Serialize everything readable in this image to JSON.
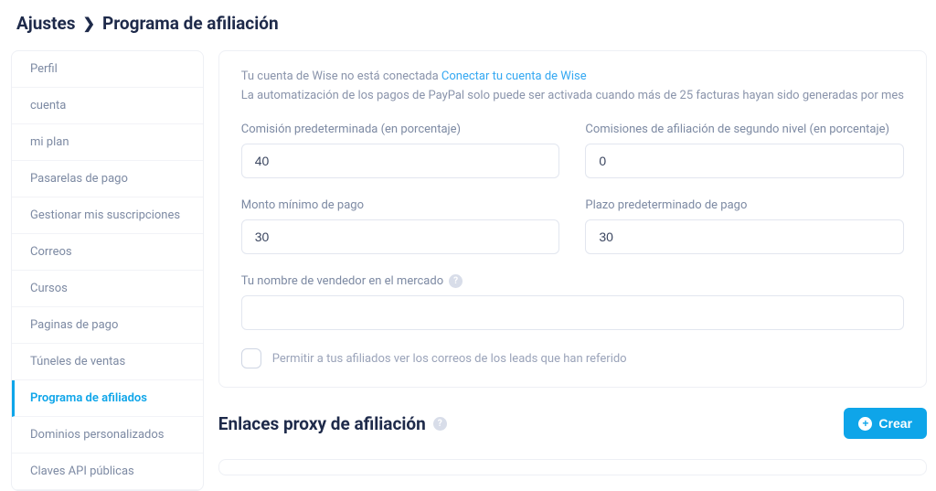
{
  "breadcrumb": {
    "root": "Ajustes",
    "current": "Programa de afiliación"
  },
  "sidebar": {
    "items": [
      {
        "label": "Perfil"
      },
      {
        "label": "cuenta"
      },
      {
        "label": "mi plan"
      },
      {
        "label": "Pasarelas de pago"
      },
      {
        "label": "Gestionar mis suscripciones"
      },
      {
        "label": "Correos"
      },
      {
        "label": "Cursos"
      },
      {
        "label": "Paginas de pago"
      },
      {
        "label": "Túneles de ventas"
      },
      {
        "label": "Programa de afiliados"
      },
      {
        "label": "Dominios personalizados"
      },
      {
        "label": "Claves API públicas"
      }
    ],
    "active_index": 9
  },
  "notice": {
    "prefix": "Tu cuenta de Wise no está conectada",
    "link": "Conectar tu cuenta de Wise",
    "line2": "La automatización de los pagos de PayPal solo puede ser activada cuando más de 25 facturas hayan sido generadas por mes"
  },
  "fields": {
    "commission": {
      "label": "Comisión predeterminada (en porcentaje)",
      "value": "40"
    },
    "second_tier": {
      "label": "Comisiones de afiliación de segundo nivel (en porcentaje)",
      "value": "0"
    },
    "min_payout": {
      "label": "Monto mínimo de pago",
      "value": "30"
    },
    "payout_term": {
      "label": "Plazo predeterminado de pago",
      "value": "30"
    },
    "vendor_name": {
      "label": "Tu nombre de vendedor en el mercado",
      "value": ""
    }
  },
  "checkbox": {
    "label": "Permitir a tus afiliados ver los correos de los leads que han referido"
  },
  "proxy_section": {
    "title": "Enlaces proxy de afiliación",
    "create_label": "Crear"
  }
}
